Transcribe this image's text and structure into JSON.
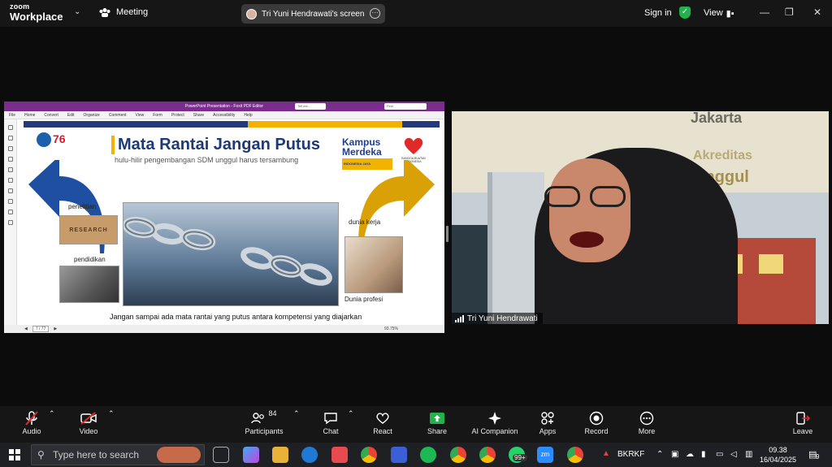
{
  "app": {
    "brand_line1": "zoom",
    "brand_line2": "Workplace"
  },
  "topbar": {
    "meeting_label": "Meeting",
    "screen_share_label": "Tri Yuni Hendrawati's screen",
    "sign_in": "Sign in",
    "view_label": "View"
  },
  "shared_screen": {
    "window_title": "PowerPoint Presentation - Foxit PDF Editor",
    "search_placeholder": "Tell me...",
    "find_label": "Find",
    "menu": [
      "File",
      "Home",
      "Convert",
      "Edit",
      "Organize",
      "Comment",
      "View",
      "Form",
      "Protect",
      "Share",
      "Accessibility",
      "Help"
    ],
    "page_indicator": "7 / 77",
    "zoom_level": "93.75%",
    "slide": {
      "title": "Mata Rantai Jangan Putus",
      "subtitle": "hulu-hilir pengembangan SDM unggul harus tersambung",
      "logo_left": "76",
      "logo_kampus": "Kampus Merdeka",
      "logo_kampus_tag": "INDONESIA JAYA",
      "logo_right": "BANGGA BUATAN INDONESIA",
      "label_penelitian": "penelitian",
      "label_pendidikan": "pendidikan",
      "label_dunia_kerja": "dunia kerja",
      "label_dunia_profesi": "Dunia profesi",
      "research_photo_text": "RESEARCH",
      "bottom_text": "Jangan sampai ada mata rantai yang putus antara kompetensi yang diajarkan"
    }
  },
  "webcam": {
    "participant_name": "Tri Yuni Hendrawati",
    "background_text_1": "Jakarta",
    "background_text_2": "Akreditas",
    "background_text_3": "Unggul"
  },
  "toolbar": {
    "audio": "Audio",
    "video": "Video",
    "participants": "Participants",
    "participants_count": "84",
    "chat": "Chat",
    "react": "React",
    "share": "Share",
    "ai_companion": "AI Companion",
    "apps": "Apps",
    "record": "Record",
    "more": "More",
    "leave": "Leave"
  },
  "taskbar": {
    "search_placeholder": "Type here to search",
    "badge_99": "99+",
    "zoom_label": "zm",
    "tray_label": "BKRKF",
    "time": "09.38",
    "date": "16/04/2025",
    "notification_count": "9"
  },
  "colors": {
    "zoom_share_green": "#22b14c",
    "foxit_purple": "#7b2d8e",
    "slide_navy": "#243a7a",
    "slide_yellow": "#f2b300",
    "leave_red": "#e02828"
  }
}
